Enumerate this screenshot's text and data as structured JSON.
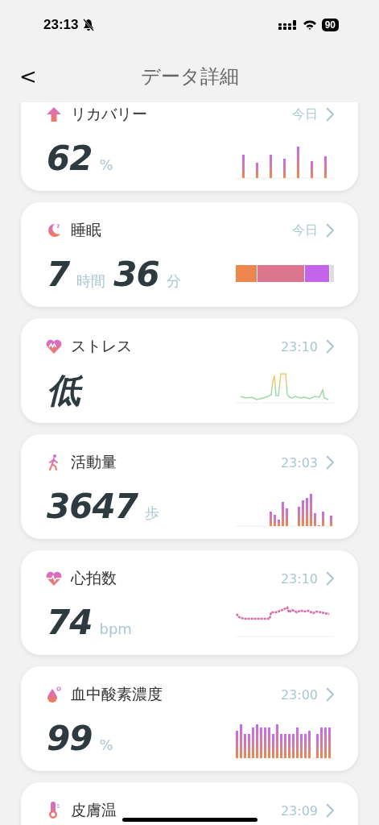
{
  "status_bar": {
    "time": "23:13",
    "battery": "90"
  },
  "header": {
    "back": "<",
    "title": "データ詳細"
  },
  "cards": [
    {
      "kind": "recovery",
      "title": "リカバリー",
      "time": "今日",
      "value": [
        {
          "number": "62",
          "unit": "%"
        }
      ]
    },
    {
      "kind": "sleep",
      "title": "睡眠",
      "time": "今日",
      "value": [
        {
          "number": "7",
          "unit": "時間"
        },
        {
          "number": "36",
          "unit": "分"
        }
      ]
    },
    {
      "kind": "stress",
      "title": "ストレス",
      "time": "23:10",
      "value": [
        {
          "number": "低"
        }
      ]
    },
    {
      "kind": "steps",
      "title": "活動量",
      "time": "23:03",
      "value": [
        {
          "number": "3647",
          "unit": "歩"
        }
      ]
    },
    {
      "kind": "heart",
      "title": "心拍数",
      "time": "23:10",
      "value": [
        {
          "number": "74",
          "unit": "bpm"
        }
      ]
    },
    {
      "kind": "oxygen",
      "title": "血中酸素濃度",
      "time": "23:00",
      "value": [
        {
          "number": "99",
          "unit": "%"
        }
      ]
    },
    {
      "kind": "temperature",
      "title": "皮膚温",
      "time": "23:09"
    }
  ]
}
